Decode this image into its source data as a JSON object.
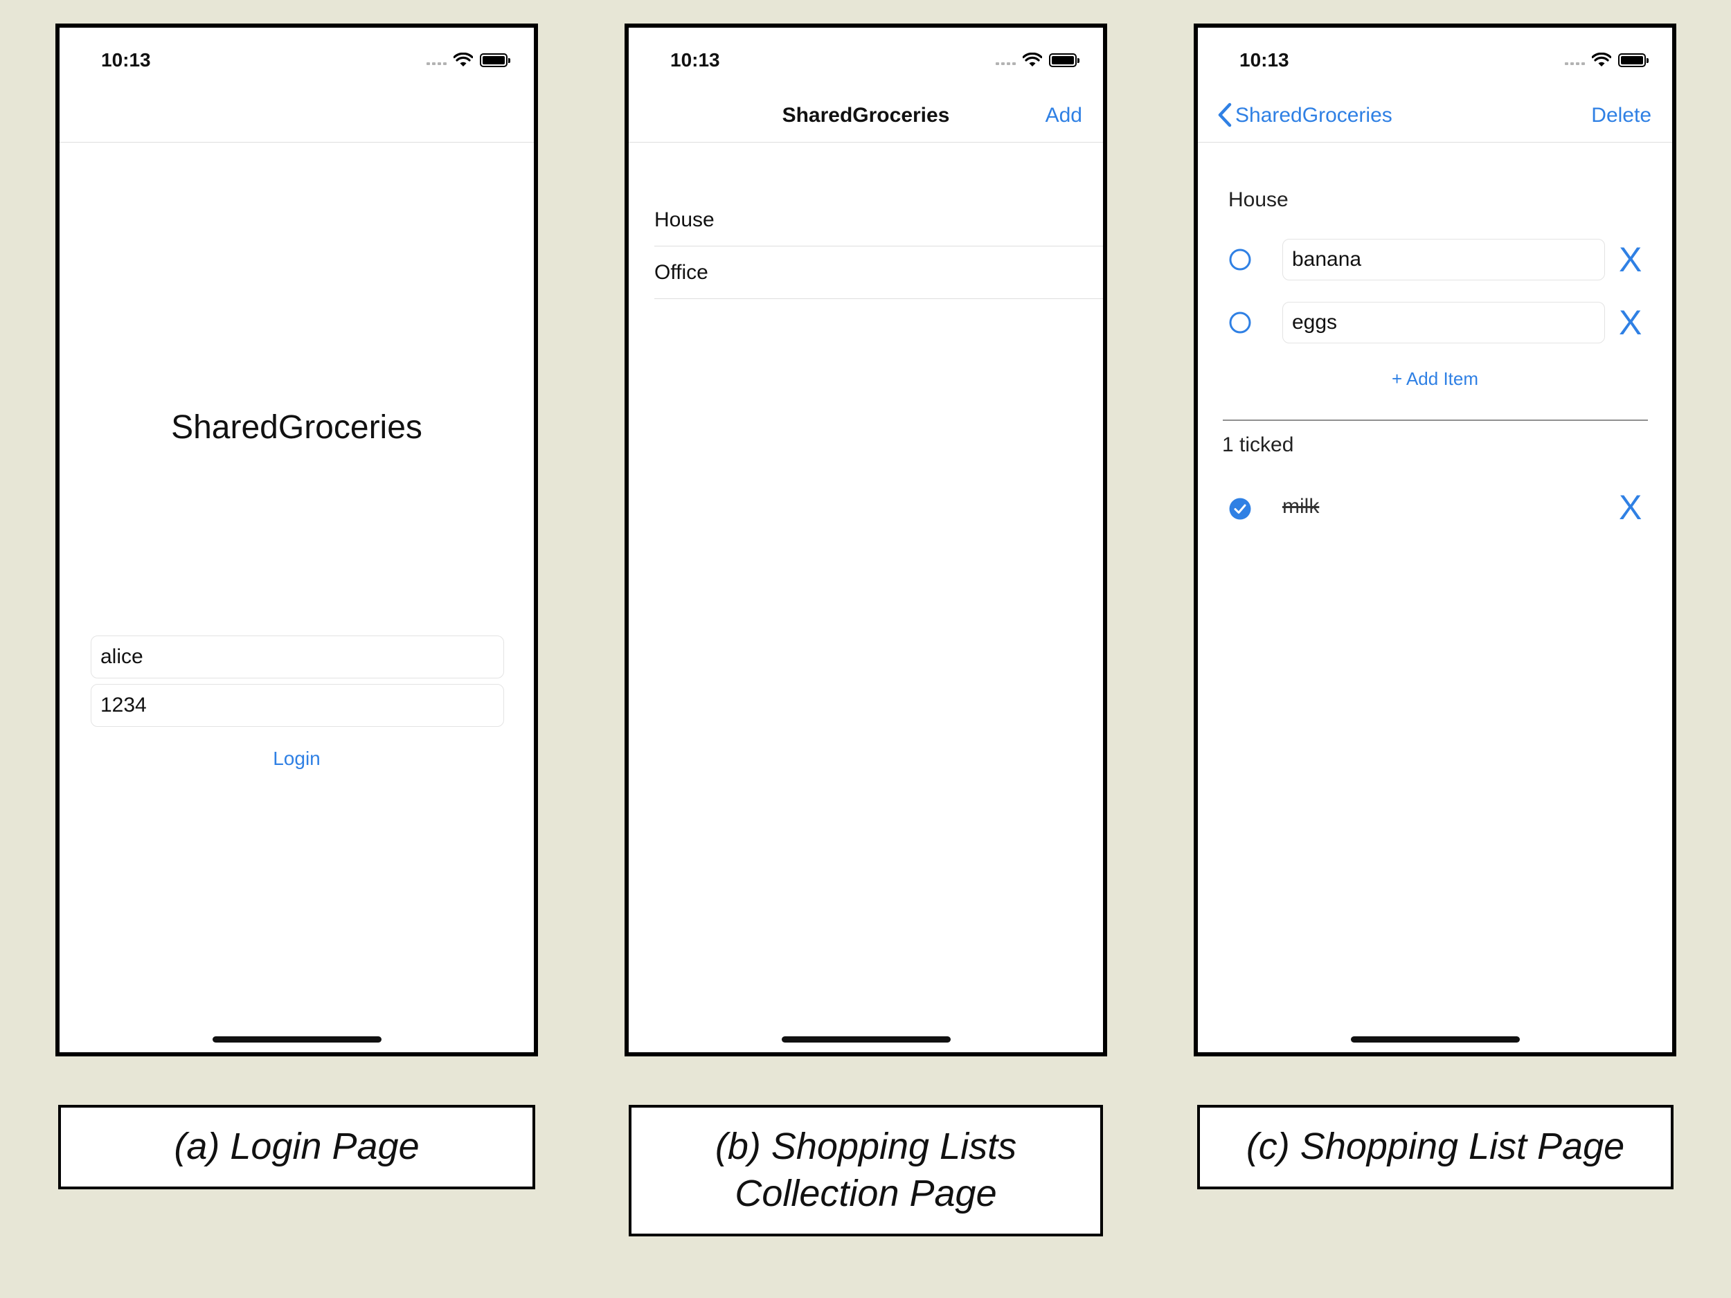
{
  "status_bar": {
    "time": "10:13"
  },
  "phone_a": {
    "app_title": "SharedGroceries",
    "username_value": "alice",
    "password_value": "1234",
    "login_label": "Login"
  },
  "phone_b": {
    "nav_title": "SharedGroceries",
    "add_label": "Add",
    "lists": [
      {
        "name": "House"
      },
      {
        "name": "Office"
      }
    ]
  },
  "phone_c": {
    "back_label": "SharedGroceries",
    "delete_label": "Delete",
    "list_name": "House",
    "items": [
      {
        "name": "banana",
        "delete_glyph": "X"
      },
      {
        "name": "eggs",
        "delete_glyph": "X"
      }
    ],
    "add_item_label": "+ Add Item",
    "ticked_header": "1 ticked",
    "ticked_items": [
      {
        "name": "milk",
        "delete_glyph": "X"
      }
    ]
  },
  "captions": {
    "a": "(a) Login Page",
    "b_line1": "(b) Shopping Lists",
    "b_line2": "Collection Page",
    "c": "(c) Shopping List Page"
  },
  "colors": {
    "accent": "#2f80e4",
    "background": "#e7e6d6"
  }
}
